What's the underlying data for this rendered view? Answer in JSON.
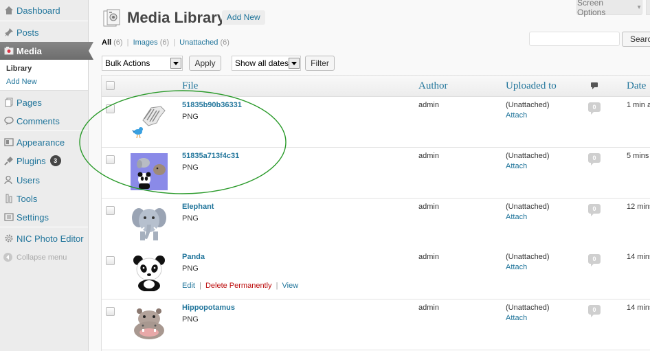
{
  "sidebar": {
    "items": [
      {
        "label": "Dashboard",
        "icon": "dashboard-icon"
      },
      {
        "label": "Posts",
        "icon": "pushpin-icon"
      },
      {
        "label": "Media",
        "icon": "media-icon"
      },
      {
        "label": "Pages",
        "icon": "pages-icon"
      },
      {
        "label": "Comments",
        "icon": "comment-bubble-icon"
      },
      {
        "label": "Appearance",
        "icon": "appearance-icon"
      },
      {
        "label": "Plugins",
        "icon": "plug-icon",
        "badge": "3"
      },
      {
        "label": "Users",
        "icon": "users-icon"
      },
      {
        "label": "Tools",
        "icon": "tools-icon"
      },
      {
        "label": "Settings",
        "icon": "settings-icon"
      },
      {
        "label": "NIC Photo Editor",
        "icon": "gear-icon"
      }
    ],
    "submenu": {
      "current": "Library",
      "add_new": "Add New"
    },
    "collapse_label": "Collapse menu"
  },
  "header": {
    "title": "Media Library",
    "add_new": "Add New",
    "screen_options": "Screen Options"
  },
  "filters": {
    "all": {
      "label": "All",
      "count": "(6)"
    },
    "images": {
      "label": "Images",
      "count": "(6)"
    },
    "unattached": {
      "label": "Unattached",
      "count": "(6)"
    },
    "separator": "|"
  },
  "search": {
    "button": "Search",
    "placeholder": ""
  },
  "toolbar": {
    "bulk_actions": "Bulk Actions",
    "apply": "Apply",
    "dates": "Show all dates",
    "filter": "Filter"
  },
  "table": {
    "columns": {
      "file": "File",
      "author": "Author",
      "uploaded_to": "Uploaded to",
      "comments_icon": "comment-bubble-icon",
      "date": "Date"
    },
    "rows": [
      {
        "title": "51835b90b36331",
        "type": "PNG",
        "author": "admin",
        "uploaded": "(Unattached)",
        "attach": "Attach",
        "comments": "0",
        "date": "1 min a",
        "thumb": "zebra-bird-image"
      },
      {
        "title": "51835a713f4c31",
        "type": "PNG",
        "author": "admin",
        "uploaded": "(Unattached)",
        "attach": "Attach",
        "comments": "0",
        "date": "5 mins",
        "thumb": "animals-collage-image"
      },
      {
        "title": "Elephant",
        "type": "PNG",
        "author": "admin",
        "uploaded": "(Unattached)",
        "attach": "Attach",
        "comments": "0",
        "date": "12 mins",
        "thumb": "elephant-image"
      },
      {
        "title": "Panda",
        "type": "PNG",
        "author": "admin",
        "uploaded": "(Unattached)",
        "attach": "Attach",
        "comments": "0",
        "date": "14 mins",
        "thumb": "panda-image",
        "actions": {
          "edit": "Edit",
          "delete": "Delete Permanently",
          "view": "View",
          "sep": "|"
        }
      },
      {
        "title": "Hippopotamus",
        "type": "PNG",
        "author": "admin",
        "uploaded": "(Unattached)",
        "attach": "Attach",
        "comments": "0",
        "date": "14 mins",
        "thumb": "hippopotamus-image"
      }
    ]
  },
  "colors": {
    "link": "#21759b",
    "current_menu": "#6d6d6d",
    "annotation": "#2a9a2a",
    "delete": "#bc0b0b"
  }
}
